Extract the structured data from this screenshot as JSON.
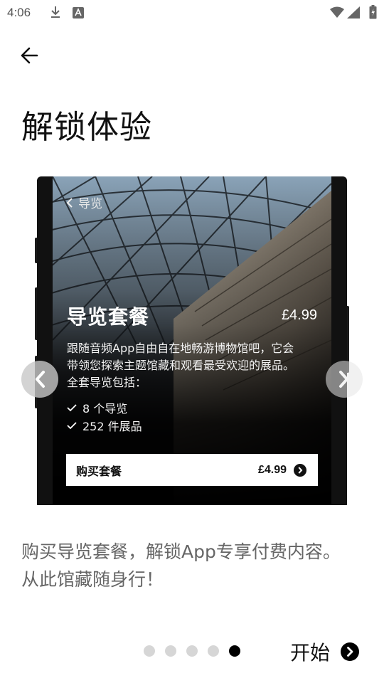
{
  "status_bar": {
    "time": "4:06"
  },
  "page": {
    "title": "解锁体验",
    "caption": "购买导览套餐，解锁App专享付费内容。从此馆藏随身行！"
  },
  "preview": {
    "back_label": "导览",
    "package_title": "导览套餐",
    "package_price": "£4.99",
    "description": "跟随音频App自由自在地畅游博物馆吧，它会带领您探索主题馆藏和观看最受欢迎的展品。全套导览包括：",
    "features": [
      "8 个导览",
      "252 件展品"
    ],
    "buy_label": "购买套餐",
    "buy_price": "£4.99"
  },
  "pager": {
    "count": 5,
    "active_index": 4
  },
  "footer": {
    "start_label": "开始"
  },
  "colors": {
    "accent": "#000000",
    "dot_inactive": "#d6d6d6",
    "caption": "#666666"
  }
}
